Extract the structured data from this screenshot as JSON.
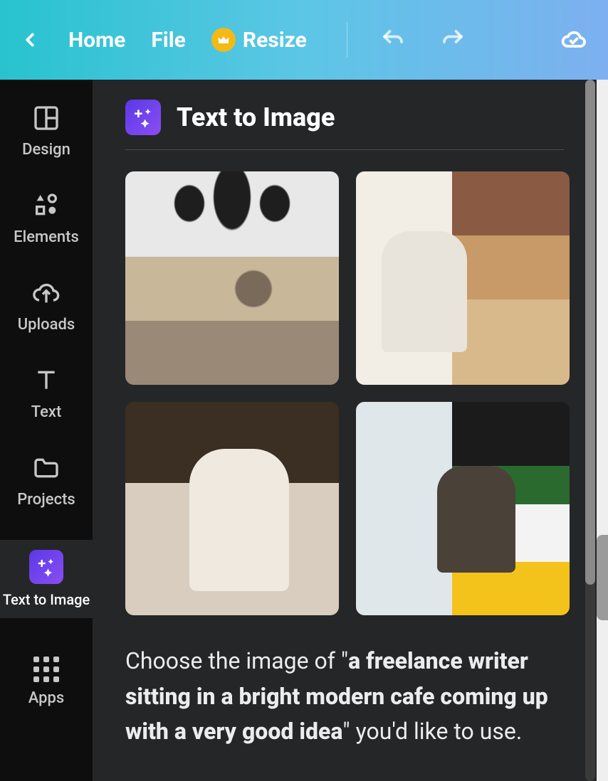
{
  "topbar": {
    "home_label": "Home",
    "file_label": "File",
    "resize_label": "Resize"
  },
  "sidebar": {
    "items": [
      {
        "label": "Design"
      },
      {
        "label": "Elements"
      },
      {
        "label": "Uploads"
      },
      {
        "label": "Text"
      },
      {
        "label": "Projects"
      },
      {
        "label": "Text to Image"
      },
      {
        "label": "Apps"
      }
    ]
  },
  "panel": {
    "title": "Text to Image",
    "prompt_prefix": "Choose the image of \"",
    "prompt_bold": "a freelance writer sitting in a bright modern cafe coming up with a very good idea",
    "prompt_suffix": "\" you'd like to use."
  }
}
